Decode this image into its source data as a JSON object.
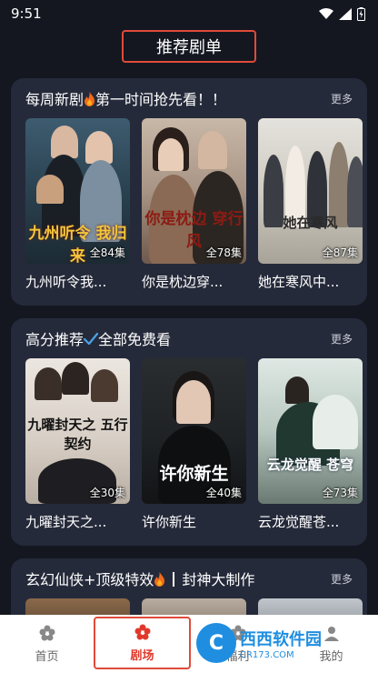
{
  "status": {
    "time": "9:51"
  },
  "header": {
    "title": "推荐剧单"
  },
  "sections": [
    {
      "title": "每周新剧",
      "title_suffix": "第一时间抢先看！！",
      "more": "更多",
      "items": [
        {
          "title": "九州听令我...",
          "episodes": "全84集",
          "poster_text": "九州听令 我归来"
        },
        {
          "title": "你是枕边穿...",
          "episodes": "全78集",
          "poster_text": "你是枕边 穿行风"
        },
        {
          "title": "她在寒风中...",
          "episodes": "全87集",
          "poster_text": "她在寒风"
        }
      ]
    },
    {
      "title": "高分推荐",
      "title_suffix": "全部免费看",
      "more": "更多",
      "items": [
        {
          "title": "九曜封天之...",
          "episodes": "全30集",
          "poster_text": "九曜封天之 五行契约"
        },
        {
          "title": "许你新生",
          "episodes": "全40集",
          "poster_text": "许你新生"
        },
        {
          "title": "云龙觉醒苍...",
          "episodes": "全73集",
          "poster_text": "云龙觉醒 苍穹"
        }
      ]
    },
    {
      "title": "玄幻仙侠+顶级特效",
      "title_suffix": "封神大制作",
      "more": "更多"
    }
  ],
  "tabs": [
    {
      "label": "首页",
      "icon": "flower-icon"
    },
    {
      "label": "剧场",
      "icon": "flower-icon"
    },
    {
      "label": "福利",
      "icon": "gift-icon"
    },
    {
      "label": "我的",
      "icon": "user-icon"
    }
  ],
  "watermark": {
    "logo": "C",
    "main": "西西软件园",
    "sub": "CR173.COM"
  },
  "colors": {
    "accent": "#e0392b",
    "card_bg": "#252a3a",
    "page_bg": "#141720"
  }
}
